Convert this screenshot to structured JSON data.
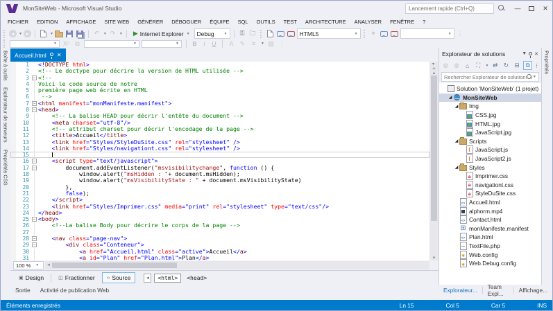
{
  "window": {
    "title": "MonSiteWeb - Microsoft Visual Studio",
    "quick_launch_placeholder": "Lancement rapide (Ctrl+Q)"
  },
  "menus": [
    "FICHIER",
    "EDITION",
    "AFFICHAGE",
    "SITE WEB",
    "GÉNÉRER",
    "DÉBOGUER",
    "ÉQUIPE",
    "SQL",
    "OUTILS",
    "TEST",
    "ARCHITECTURE",
    "ANALYSER",
    "FENÊTRE",
    "?"
  ],
  "toolbar": {
    "run_target": "Internet Explorer",
    "config": "Debug",
    "doctype": "HTML5"
  },
  "left_tabs": [
    "Boîte à outils",
    "Explorateur de serveurs",
    "Propriétés CSS"
  ],
  "right_tab": "Propriétés",
  "editor": {
    "tab": "Accueil.html",
    "zoom": "100 %",
    "lines": [
      {
        "n": 1,
        "fold": "",
        "seg": [
          [
            "d",
            "<!"
          ],
          [
            "t",
            "DOCTYPE"
          ],
          [
            "a",
            " html"
          ],
          [
            "d",
            ">"
          ]
        ]
      },
      {
        "n": 2,
        "fold": "",
        "seg": [
          [
            "c",
            "<!-- Le doctype pour décrire la version de HTML utilisée -->"
          ]
        ]
      },
      {
        "n": 3,
        "fold": "box",
        "seg": [
          [
            "c",
            "<!--"
          ]
        ]
      },
      {
        "n": 4,
        "fold": "v",
        "seg": [
          [
            "c",
            "Voici le code source de notre"
          ]
        ]
      },
      {
        "n": 5,
        "fold": "v",
        "seg": [
          [
            "c",
            "première page web écrite en HTML"
          ]
        ]
      },
      {
        "n": 6,
        "fold": "v",
        "seg": [
          [
            "c",
            " -->"
          ]
        ]
      },
      {
        "n": 7,
        "fold": "box",
        "seg": [
          [
            "d",
            "<"
          ],
          [
            "t",
            "html"
          ],
          [
            "a",
            " manifest"
          ],
          [
            "d",
            "=\"monManifeste.manifest\">"
          ]
        ]
      },
      {
        "n": 8,
        "fold": "box",
        "seg": [
          [
            "d",
            "<"
          ],
          [
            "t",
            "head"
          ],
          [
            "d",
            ">"
          ]
        ]
      },
      {
        "n": 9,
        "fold": "v",
        "seg": [
          [
            "x",
            "    "
          ],
          [
            "c",
            "<!-- La balise HEAD pour décrir l'entête du document -->"
          ]
        ]
      },
      {
        "n": 10,
        "fold": "v",
        "seg": [
          [
            "x",
            "    "
          ],
          [
            "d",
            "<"
          ],
          [
            "t",
            "meta"
          ],
          [
            "a",
            " charset"
          ],
          [
            "d",
            "=\"utf-8\"/>"
          ]
        ]
      },
      {
        "n": 11,
        "fold": "v",
        "seg": [
          [
            "x",
            "    "
          ],
          [
            "c",
            "<!-- attribut charset pour décrir l'encodage de la page -->"
          ]
        ]
      },
      {
        "n": 12,
        "fold": "v",
        "seg": [
          [
            "x",
            "    "
          ],
          [
            "d",
            "<"
          ],
          [
            "t",
            "title"
          ],
          [
            "d",
            ">"
          ],
          [
            "x",
            "Accueil"
          ],
          [
            "d",
            "</"
          ],
          [
            "t",
            "title"
          ],
          [
            "d",
            ">"
          ]
        ]
      },
      {
        "n": 13,
        "fold": "v",
        "seg": [
          [
            "x",
            "    "
          ],
          [
            "d",
            "<"
          ],
          [
            "t",
            "link"
          ],
          [
            "a",
            " href"
          ],
          [
            "d",
            "=\"Styles/StyleDuSite.css\""
          ],
          [
            "a",
            " rel"
          ],
          [
            "d",
            "=\"stylesheet\" />"
          ]
        ]
      },
      {
        "n": 14,
        "fold": "v",
        "seg": [
          [
            "x",
            "    "
          ],
          [
            "d",
            "<"
          ],
          [
            "t",
            "link"
          ],
          [
            "a",
            " href"
          ],
          [
            "d",
            "=\"Styles/navigationt.css\""
          ],
          [
            "a",
            " rel"
          ],
          [
            "d",
            "=\"stylesheet\" />"
          ]
        ]
      },
      {
        "n": 15,
        "fold": "v",
        "current": true,
        "caret": true,
        "seg": [
          [
            "x",
            "    "
          ]
        ]
      },
      {
        "n": 16,
        "fold": "box",
        "seg": [
          [
            "x",
            "    "
          ],
          [
            "d",
            "<"
          ],
          [
            "t",
            "script"
          ],
          [
            "a",
            " type"
          ],
          [
            "d",
            "=\"text/javascript\""
          ],
          [
            "d",
            ">"
          ]
        ]
      },
      {
        "n": 17,
        "fold": "box",
        "seg": [
          [
            "x",
            "        document.addEventListener("
          ],
          [
            "s",
            "\"msvisibilitychange\""
          ],
          [
            "x",
            ", "
          ],
          [
            "k",
            "function"
          ],
          [
            "x",
            " () {"
          ]
        ]
      },
      {
        "n": 18,
        "fold": "v",
        "seg": [
          [
            "x",
            "            window.alert("
          ],
          [
            "s",
            "\"msHidden : \""
          ],
          [
            "x",
            "+ document.msHidden);"
          ]
        ]
      },
      {
        "n": 19,
        "fold": "v",
        "seg": [
          [
            "x",
            "            window.alert("
          ],
          [
            "s",
            "\"msVisibilityState : \""
          ],
          [
            "x",
            " + document.msVisibilityState)"
          ]
        ]
      },
      {
        "n": 20,
        "fold": "v",
        "seg": [
          [
            "x",
            "        },"
          ]
        ]
      },
      {
        "n": 21,
        "fold": "v",
        "seg": [
          [
            "x",
            "        "
          ],
          [
            "k",
            "false"
          ],
          [
            "x",
            ");"
          ]
        ]
      },
      {
        "n": 22,
        "fold": "v",
        "seg": [
          [
            "x",
            "    "
          ],
          [
            "d",
            "</"
          ],
          [
            "t",
            "script"
          ],
          [
            "d",
            ">"
          ]
        ]
      },
      {
        "n": 23,
        "fold": "v",
        "seg": [
          [
            "x",
            "    "
          ],
          [
            "d",
            "<"
          ],
          [
            "t",
            "link"
          ],
          [
            "a",
            " href"
          ],
          [
            "d",
            "=\"Styles/Imprimer.css\""
          ],
          [
            "a",
            " media"
          ],
          [
            "d",
            "=\"print\""
          ],
          [
            "a",
            " rel"
          ],
          [
            "d",
            "=\"stylesheet\""
          ],
          [
            "a",
            " type"
          ],
          [
            "d",
            "=\"text/css\"/>"
          ]
        ]
      },
      {
        "n": 24,
        "fold": "v",
        "seg": [
          [
            "d",
            "</"
          ],
          [
            "t",
            "head"
          ],
          [
            "d",
            ">"
          ]
        ]
      },
      {
        "n": 25,
        "fold": "box",
        "seg": [
          [
            "d",
            "<"
          ],
          [
            "t",
            "body"
          ],
          [
            "d",
            ">"
          ]
        ]
      },
      {
        "n": 26,
        "fold": "v",
        "seg": [
          [
            "x",
            "    "
          ],
          [
            "c",
            "<!--La balise Body pour décrire le corps de la page -->"
          ]
        ]
      },
      {
        "n": 27,
        "fold": "v",
        "seg": []
      },
      {
        "n": 28,
        "fold": "box",
        "seg": [
          [
            "x",
            "    "
          ],
          [
            "d",
            "<"
          ],
          [
            "t",
            "nav"
          ],
          [
            "a",
            " class"
          ],
          [
            "d",
            "=\"page-nav\">"
          ]
        ]
      },
      {
        "n": 29,
        "fold": "box",
        "seg": [
          [
            "x",
            "        "
          ],
          [
            "d",
            "<"
          ],
          [
            "t",
            "div"
          ],
          [
            "a",
            " class"
          ],
          [
            "d",
            "=\"Conteneur\">"
          ]
        ]
      },
      {
        "n": 30,
        "fold": "v",
        "seg": [
          [
            "x",
            "            "
          ],
          [
            "d",
            "<"
          ],
          [
            "t",
            "a"
          ],
          [
            "a",
            " href"
          ],
          [
            "d",
            "=\"Accueil.html\""
          ],
          [
            "a",
            " class"
          ],
          [
            "d",
            "=\"active\">"
          ],
          [
            "x",
            "Accueil"
          ],
          [
            "d",
            "</"
          ],
          [
            "t",
            "a"
          ],
          [
            "d",
            ">"
          ]
        ]
      },
      {
        "n": 31,
        "fold": "v",
        "seg": [
          [
            "x",
            "            "
          ],
          [
            "d",
            "<"
          ],
          [
            "t",
            "a"
          ],
          [
            "a",
            " id"
          ],
          [
            "d",
            "=\"Plan\""
          ],
          [
            "a",
            " href"
          ],
          [
            "d",
            "=\"Plan.html\">"
          ],
          [
            "x",
            "Plan"
          ],
          [
            "d",
            "</"
          ],
          [
            "t",
            "a"
          ],
          [
            "d",
            ">"
          ]
        ]
      }
    ]
  },
  "bottom_bar": {
    "design": "Design",
    "split": "Fractionner",
    "source": "Source",
    "breadcrumbs": [
      "<html>",
      "<head>"
    ]
  },
  "panel_tabs": {
    "left": [
      "Sortie",
      "Activité de publication Web"
    ],
    "right": [
      "Explorateur...",
      "Team Expl...",
      "Affichage..."
    ]
  },
  "solution_explorer": {
    "title": "Explorateur de solutions",
    "search_placeholder": "Rechercher Explorateur de solutions",
    "tree": [
      {
        "depth": 0,
        "icon": "solution",
        "label": "Solution 'MonSiteWeb' (1 projet)"
      },
      {
        "depth": 1,
        "icon": "globe",
        "label": "MonSiteWeb",
        "bold": true,
        "expanded": true,
        "selected": true
      },
      {
        "depth": 2,
        "icon": "folder",
        "label": "Img",
        "expanded": true
      },
      {
        "depth": 3,
        "icon": "image",
        "label": "CSS.jpg"
      },
      {
        "depth": 3,
        "icon": "image",
        "label": "HTML.jpg"
      },
      {
        "depth": 3,
        "icon": "image",
        "label": "JavaScript.jpg"
      },
      {
        "depth": 2,
        "icon": "folder",
        "label": "Scripts",
        "expanded": true
      },
      {
        "depth": 3,
        "icon": "js",
        "label": "JavaScript.js"
      },
      {
        "depth": 3,
        "icon": "js",
        "label": "JavaScript2.js"
      },
      {
        "depth": 2,
        "icon": "folder",
        "label": "Styles",
        "expanded": true
      },
      {
        "depth": 3,
        "icon": "css",
        "label": "Imprimer.css"
      },
      {
        "depth": 3,
        "icon": "css",
        "label": "navigationt.css"
      },
      {
        "depth": 3,
        "icon": "css",
        "label": "StyleDuSite.css"
      },
      {
        "depth": 2,
        "icon": "html",
        "label": "Accueil.html"
      },
      {
        "depth": 2,
        "icon": "video",
        "label": "alphorm.mp4"
      },
      {
        "depth": 2,
        "icon": "html",
        "label": "Contact.html"
      },
      {
        "depth": 2,
        "icon": "manifest",
        "label": "monManifeste.manifest"
      },
      {
        "depth": 2,
        "icon": "html",
        "label": "Plan.html"
      },
      {
        "depth": 2,
        "icon": "php",
        "label": "TextFile.php"
      },
      {
        "depth": 2,
        "icon": "config",
        "label": "Web.config"
      },
      {
        "depth": 2,
        "icon": "config",
        "label": "Web.Debug.config"
      }
    ]
  },
  "status_bar": {
    "message": "Éléments enregistrés",
    "ln": "Ln 15",
    "col": "Col 5",
    "car": "Car 5",
    "mode": "INS"
  }
}
